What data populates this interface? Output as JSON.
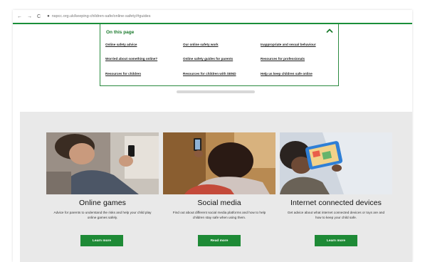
{
  "address_bar": {
    "back": "←",
    "forward": "→",
    "reload": "C",
    "url": "nspcc.org.uk/keeping-children-safe/online-safety/#guides"
  },
  "on_this_page": {
    "title": "On this page",
    "links": [
      "Online safety advice",
      "Our online safety work",
      "Inappropriate and sexual behaviour",
      "Worried about something online?",
      "Online safety guides for parents",
      "Resources for professionals",
      "Resources for children",
      "Resources for children with SEND",
      "Help us keep children safe online"
    ]
  },
  "cards": [
    {
      "title": "Online games",
      "description": "Advice for parents to understand the risks and help your child play online games safely.",
      "button": "Learn more"
    },
    {
      "title": "Social media",
      "description": "Find out about different social media platforms and how to help children stay safe when using them.",
      "button": "Read more"
    },
    {
      "title": "Internet connected devices",
      "description": "Get advice about what internet connected devices or toys are and how to keep your child safe.",
      "button": "Learn more"
    }
  ],
  "colors": {
    "brand_green": "#1e8a36",
    "toc_title": "#1a7a2c",
    "section_bg": "#e9e9e9"
  }
}
